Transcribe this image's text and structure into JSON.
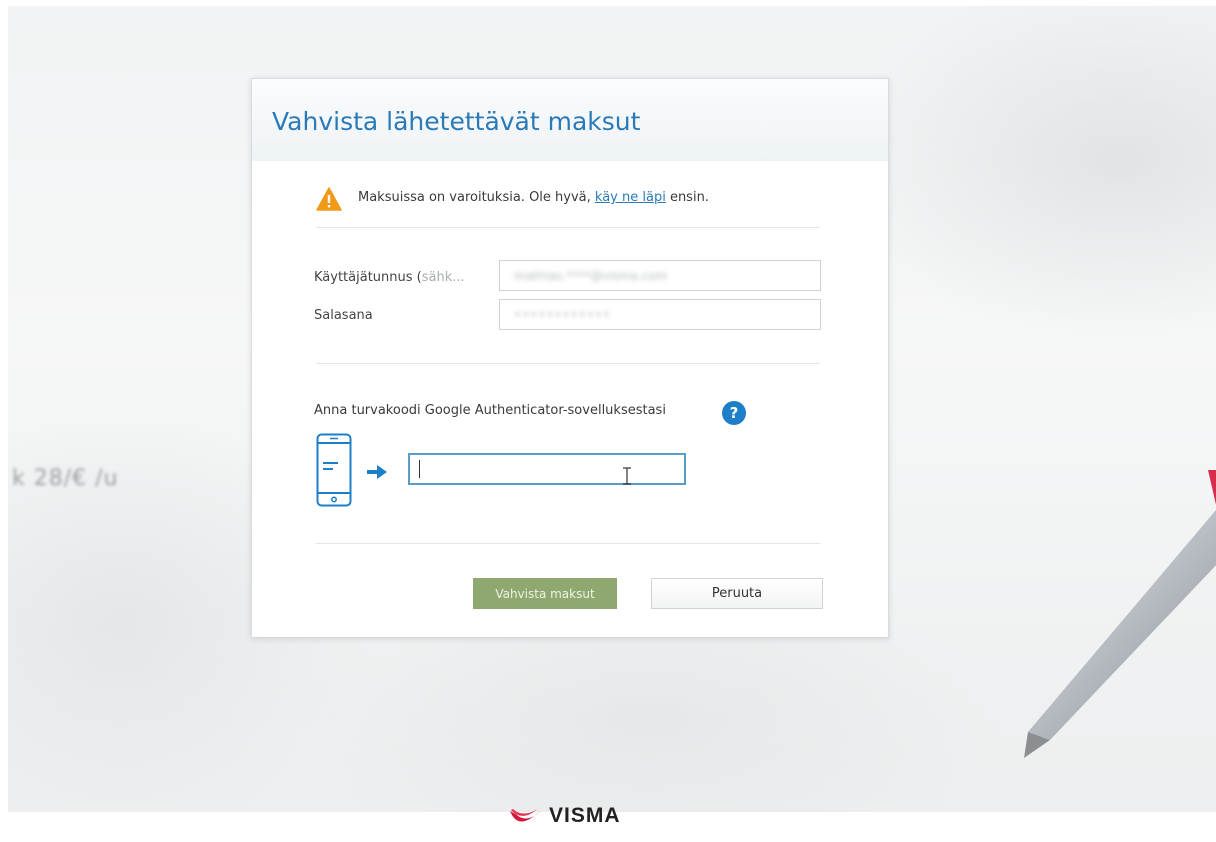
{
  "background": {
    "blur_text": "k 28/€ /u"
  },
  "dialog": {
    "title": "Vahvista lähetettävät maksut",
    "warning": {
      "icon": "warning-triangle-icon",
      "text_before": "Maksuissa on varoituksia. Ole hyvä, ",
      "link_text": "käy ne läpi",
      "text_after": " ensin."
    },
    "username": {
      "label_main": "Käyttäjätunnus (",
      "label_muted": "sähk...",
      "value": "mathias.****@visma.com"
    },
    "password": {
      "label": "Salasana",
      "value": "••••••••••••"
    },
    "auth": {
      "label": "Anna turvakoodi Google Authenticator-sovelluksestasi",
      "help_symbol": "?",
      "code_value": ""
    },
    "buttons": {
      "confirm_label": "Vahvista maksut",
      "cancel_label": "Peruuta"
    }
  },
  "footer": {
    "brand": "VISMA"
  },
  "colors": {
    "title_blue": "#2a7ab8",
    "warning_orange": "#f19a1a",
    "help_blue": "#1e7fc9",
    "confirm_green": "#8ea870",
    "visma_red": "#d3173a"
  }
}
